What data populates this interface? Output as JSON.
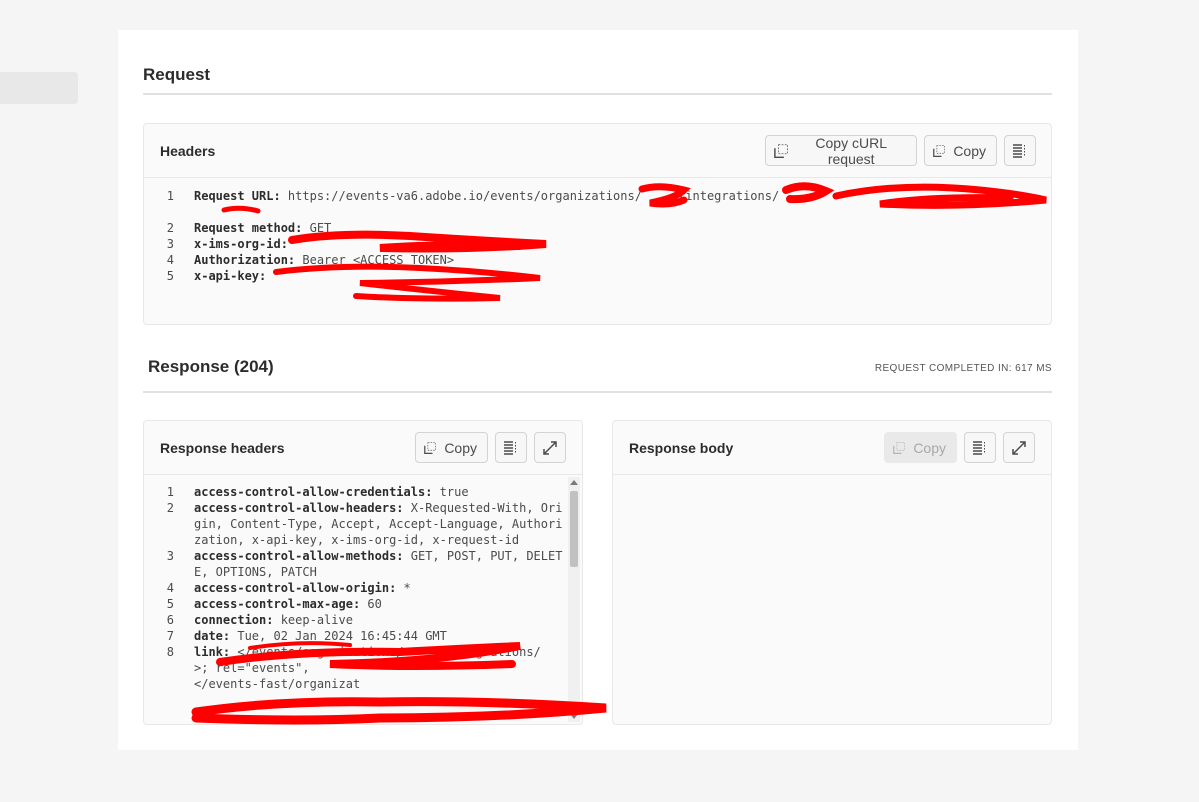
{
  "request": {
    "title": "Request",
    "headers_panel": {
      "title": "Headers",
      "copy_curl_label": "Copy cURL request",
      "copy_label": "Copy",
      "lines": [
        {
          "num": "1",
          "key": "Request URL:",
          "value": " https://events-va6.adobe.io/events/organizations/     /integrations/"
        },
        {
          "num": "2",
          "key": "Request method:",
          "value": " GET"
        },
        {
          "num": "3",
          "key": "x-ims-org-id:",
          "value": " "
        },
        {
          "num": "4",
          "key": "Authorization:",
          "value": " Bearer <ACCESS_TOKEN>"
        },
        {
          "num": "5",
          "key": "x-api-key:",
          "value": " "
        }
      ]
    }
  },
  "response": {
    "title": "Response (204)",
    "completed": "REQUEST COMPLETED IN: 617 MS",
    "headers_panel": {
      "title": "Response headers",
      "copy_label": "Copy",
      "lines": [
        {
          "num": "1",
          "key": "access-control-allow-credentials:",
          "value": " true"
        },
        {
          "num": "2",
          "key": "access-control-allow-headers:",
          "value": " X-Requested-With, Origin, Content-Type, Accept, Accept-Language, Authorization, x-api-key, x-ims-org-id, x-request-id"
        },
        {
          "num": "3",
          "key": "access-control-allow-methods:",
          "value": " GET, POST, PUT, DELETE, OPTIONS, PATCH"
        },
        {
          "num": "4",
          "key": "access-control-allow-origin:",
          "value": " *"
        },
        {
          "num": "5",
          "key": "access-control-max-age:",
          "value": " 60"
        },
        {
          "num": "6",
          "key": "connection:",
          "value": " keep-alive"
        },
        {
          "num": "7",
          "key": "date:",
          "value": " Tue, 02 Jan 2024 16:45:44 GMT"
        },
        {
          "num": "8",
          "key": "link:",
          "value": " </events/organizations/     /integrations/                            >; rel=\"events\",\n</events-fast/organizat"
        }
      ]
    },
    "body_panel": {
      "title": "Response body",
      "copy_label": "Copy"
    }
  },
  "colors": {
    "redaction": "#ff0000"
  },
  "icons": {
    "copy": "copy-icon",
    "wrap": "wrap-lines-icon",
    "expand": "expand-icon"
  }
}
